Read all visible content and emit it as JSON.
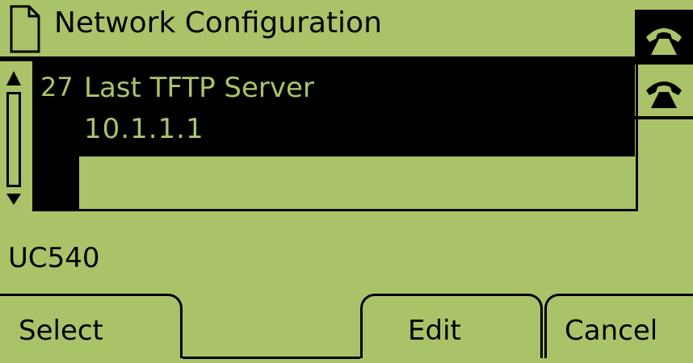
{
  "screen": {
    "title": "Network Configuration",
    "icons": {
      "document": "document-icon",
      "line1": "phone-handset-icon",
      "line2": "phone-handset-icon",
      "scroll_up": "triangle-up-icon",
      "scroll_down": "triangle-down-icon"
    }
  },
  "list": {
    "selected_item": {
      "index": "27",
      "label": "Last TFTP Server",
      "value": "10.1.1.1"
    }
  },
  "status": {
    "text": "UC540"
  },
  "softkeys": {
    "select": "Select",
    "edit": "Edit",
    "cancel": "Cancel"
  },
  "colors": {
    "lcd_background": "#aac369",
    "foreground": "#000000"
  }
}
